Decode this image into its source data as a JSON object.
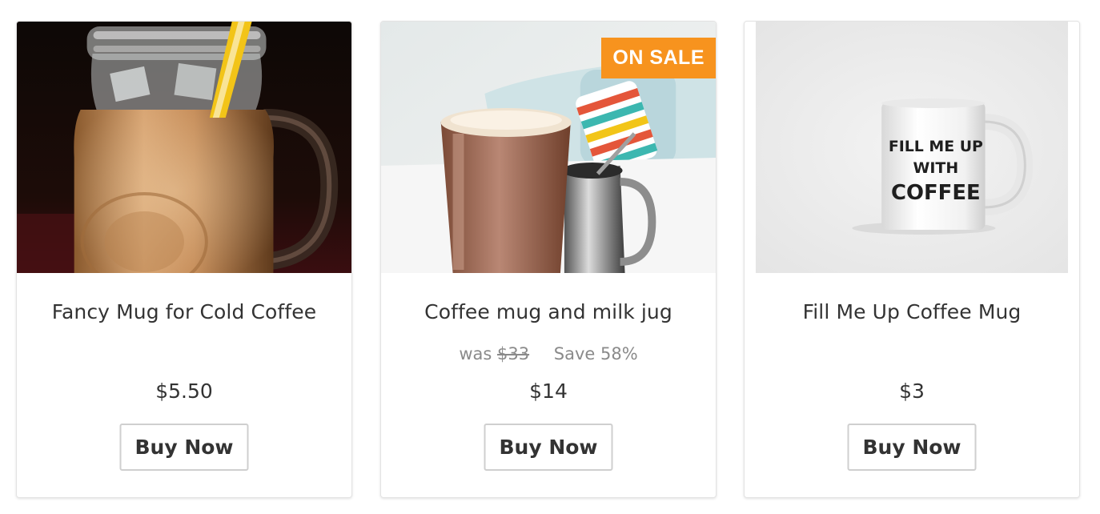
{
  "products": [
    {
      "title": "Fancy Mug for Cold Coffee",
      "price": "$5.50",
      "button_label": "Buy Now"
    },
    {
      "title": "Coffee mug and milk jug",
      "badge": "ON SALE",
      "was_label": "was",
      "was_price": "$33",
      "save_text": "Save 58%",
      "price": "$14",
      "button_label": "Buy Now"
    },
    {
      "title": "Fill Me Up Coffee Mug",
      "price": "$3",
      "button_label": "Buy Now",
      "mug_print": [
        "FILL ME UP",
        "WITH",
        "COFFEE"
      ]
    }
  ],
  "colors": {
    "badge": "#f7931e",
    "text": "#333333",
    "muted": "#8a8a8a",
    "border": "#e3e3e3"
  }
}
